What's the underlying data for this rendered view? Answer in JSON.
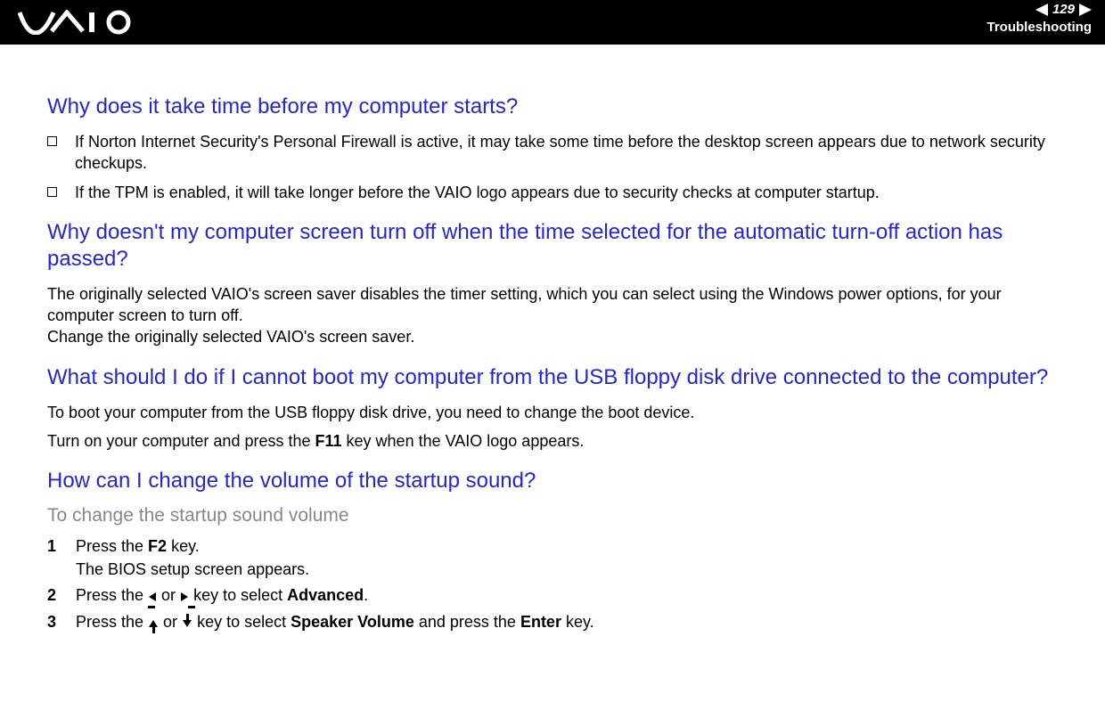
{
  "header": {
    "page_number": "129",
    "section": "Troubleshooting"
  },
  "q1": {
    "title": "Why does it take time before my computer starts?",
    "bullets": [
      "If Norton Internet Security's Personal Firewall is active, it may take some time before the desktop screen appears due to network security checkups.",
      "If the TPM is enabled, it will take longer before the VAIO logo appears due to security checks at computer startup."
    ]
  },
  "q2": {
    "title": "Why doesn't my computer screen turn off when the time selected for the automatic turn-off action has passed?",
    "para1": "The originally selected VAIO's screen saver disables the timer setting, which you can select using the Windows power options, for your computer screen to turn off.",
    "para2": "Change the originally selected VAIO's screen saver."
  },
  "q3": {
    "title": "What should I do if I cannot boot my computer from the USB floppy disk drive connected to the computer?",
    "para1": "To boot your computer from the USB floppy disk drive, you need to change the boot device.",
    "para2_pre": "Turn on your computer and press the ",
    "para2_key": "F11",
    "para2_post": " key when the VAIO logo appears."
  },
  "q4": {
    "title": "How can I change the volume of the startup sound?",
    "subtitle": "To change the startup sound volume",
    "steps": {
      "s1_pre": "Press the ",
      "s1_key": "F2",
      "s1_mid": " key.",
      "s1_line2": "The BIOS setup screen appears.",
      "s2_pre": "Press the ",
      "s2_or": " or ",
      "s2_mid": " key to select ",
      "s2_adv": "Advanced",
      "s2_end": ".",
      "s3_pre": "Press the ",
      "s3_or": " or ",
      "s3_mid": " key to select ",
      "s3_spk": "Speaker Volume",
      "s3_and": " and press the ",
      "s3_enter": "Enter",
      "s3_end": " key."
    }
  }
}
